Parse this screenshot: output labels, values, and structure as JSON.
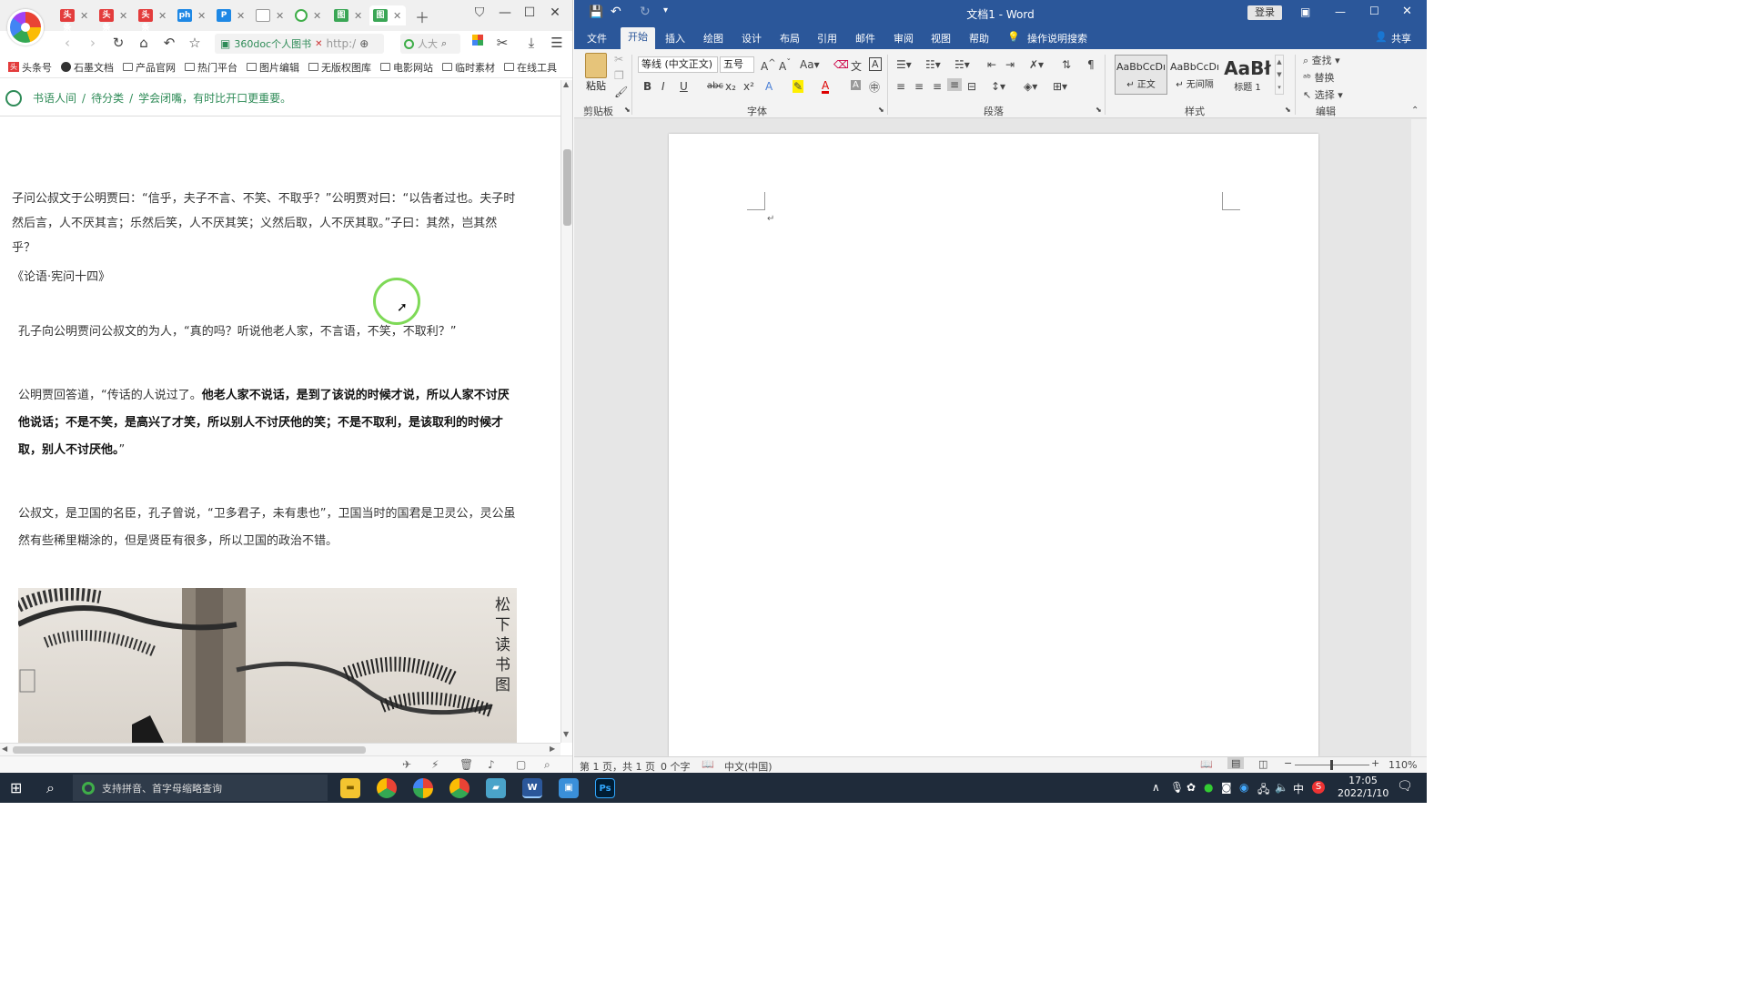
{
  "browser": {
    "tabs": [
      {
        "icon": "toutiao-icon",
        "label": "头条",
        "color": "#e33c3c"
      },
      {
        "icon": "toutiao-icon",
        "label": "头条",
        "color": "#e33c3c"
      },
      {
        "icon": "toutiao-icon",
        "label": "头条",
        "color": "#e33c3c"
      },
      {
        "icon": "ph-icon",
        "label": "ph",
        "color": "#1e88e5"
      },
      {
        "icon": "p-icon",
        "label": "P",
        "color": "#1e88e5"
      },
      {
        "icon": "table-icon",
        "label": "",
        "color": "#999999"
      },
      {
        "icon": "search360-icon",
        "label": "",
        "color": "#3fae49"
      },
      {
        "icon": "doc360-icon",
        "label": "图",
        "color": "#3aa655"
      },
      {
        "icon": "doc360-icon",
        "label": "图",
        "color": "#3aa655"
      }
    ],
    "address": {
      "site": "360doc个人图书",
      "url": "http:/"
    },
    "search_placeholder": "人大",
    "bookmarks": [
      "头条号",
      "石墨文档",
      "产品官网",
      "热门平台",
      "图片编辑",
      "无版权图库",
      "电影网站",
      "临时素材",
      "在线工具"
    ],
    "breadcrumb": {
      "root": "书语人间",
      "sep1": "/",
      "category": "待分类",
      "sep2": "/",
      "title": "学会闭嘴，有时比开口更重要。"
    },
    "article": {
      "p1": "子问公叔文于公明贾曰：“信乎，夫子不言、不笑、不取乎？”公明贾对曰：“以告者过也。夫子时然后言，人不厌其言；乐然后笑，人不厌其笑；义然后取，人不厌其取。”子曰：其然，岂其然乎？",
      "source": "《论语·宪问十四》",
      "p2": "孔子向公明贾问公叔文的为人，“真的吗？听说他老人家，不言语，不笑，不取利？”",
      "p3_normal": "公明贾回答道，“传话的人说过了。",
      "p3_bold": "他老人家不说话，是到了该说的时候才说，所以人家不讨厌他说话；不是不笑，是高兴了才笑，所以别人不讨厌他的笑；不是不取利，是该取利的时候才取，别人不讨厌他。",
      "p3_end": "”",
      "p4": "公叔文，是卫国的名臣，孔子曾说，“卫多君子，未有患也”，卫国当时的国君是卫灵公，灵公虽然有些稀里糊涂的，但是贤臣有很多，所以卫国的政治不错。",
      "painting_inscription": "松下读书图"
    }
  },
  "word": {
    "title": "文档1  -  Word",
    "login": "登录",
    "tabs": [
      "文件",
      "开始",
      "插入",
      "绘图",
      "设计",
      "布局",
      "引用",
      "邮件",
      "审阅",
      "视图",
      "帮助"
    ],
    "active_tab": "开始",
    "tell_me": "操作说明搜索",
    "share": "共享",
    "ribbon": {
      "paste": "粘贴",
      "clipboard": "剪贴板",
      "font_name": "等线 (中文正文)",
      "font_size": "五号",
      "font_group": "字体",
      "paragraph_group": "段落",
      "styles_group": "样式",
      "editing_group": "编辑",
      "styles": [
        {
          "sample": "AaBbCcDı",
          "name": "↵ 正文"
        },
        {
          "sample": "AaBbCcDı",
          "name": "↵ 无间隔"
        },
        {
          "sample": "AaBł",
          "name": "标题 1"
        }
      ],
      "find": "查找",
      "replace": "替换",
      "select": "选择"
    },
    "status": {
      "page": "第 1 页，共 1 页",
      "words": "0 个字",
      "lang": "中文(中国)",
      "zoom": "110%"
    }
  },
  "taskbar": {
    "search_placeholder": "支持拼音、首字母缩略查询",
    "ime": "中",
    "time": "17:05",
    "date": "2022/1/10"
  }
}
